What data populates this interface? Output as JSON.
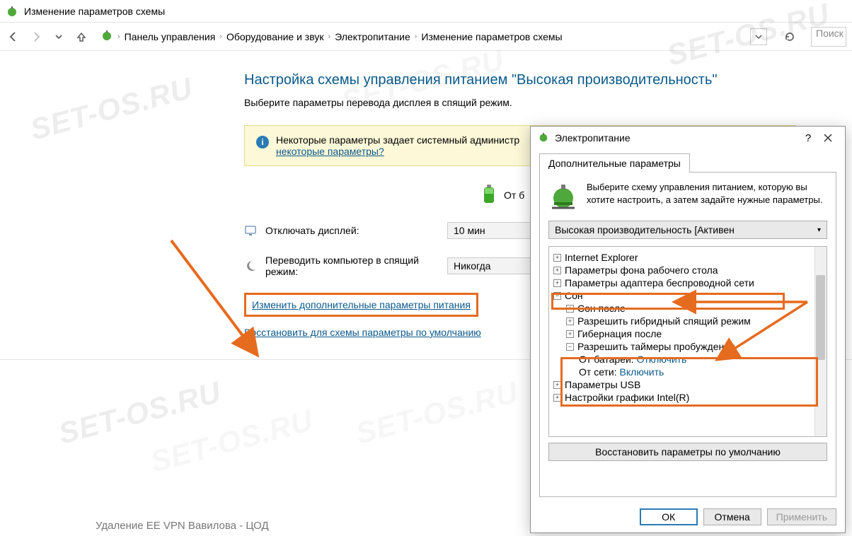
{
  "titlebar": {
    "title": "Изменение параметров схемы"
  },
  "breadcrumb": {
    "items": [
      "Панель управления",
      "Оборудование и звук",
      "Электропитание",
      "Изменение параметров схемы"
    ]
  },
  "search": {
    "placeholder": "Поиск"
  },
  "page": {
    "title": "Настройка схемы управления питанием \"Высокая производительность\"",
    "subtitle": "Выберите параметры перевода дисплея в спящий режим."
  },
  "notice": {
    "text_prefix": "Некоторые параметры задает системный администр",
    "link": "некоторые параметры?"
  },
  "battery_label": "От б",
  "settings": {
    "display_off": {
      "label": "Отключать дисплей:",
      "value": "10 мин"
    },
    "sleep": {
      "label": "Переводить компьютер в спящий режим:",
      "value": "Никогда"
    }
  },
  "links": {
    "advanced": "Изменить дополнительные параметры питания",
    "restore": "Восстановить для схемы параметры по умолчанию"
  },
  "dialog": {
    "title": "Электропитание",
    "tab": "Дополнительные параметры",
    "description": "Выберите схему управления питанием, которую вы хотите настроить, а затем задайте нужные параметры.",
    "plan": "Высокая производительность [Активен",
    "tree": {
      "ie": "Internet Explorer",
      "desktop_bg": "Параметры фона рабочего стола",
      "wifi": "Параметры адаптера беспроводной сети",
      "sleep": "Сон",
      "sleep_after": "Сон после",
      "hybrid": "Разрешить гибридный спящий режим",
      "hibernate": "Гибернация после",
      "wake_timers": "Разрешить таймеры пробуждения",
      "on_battery_label": "От батареи:",
      "on_battery_value": "Отключить",
      "on_ac_label": "От сети:",
      "on_ac_value": "Включить",
      "usb": "Параметры USB",
      "intel": "Настройки графики Intel(R)"
    },
    "restore_defaults": "Восстановить параметры по умолчанию",
    "buttons": {
      "ok": "ОК",
      "cancel": "Отмена",
      "apply": "Применить"
    }
  },
  "watermark": "SET-OS.RU",
  "bottom_text": "Удаление EE VPN Вавилова - ЦОД"
}
